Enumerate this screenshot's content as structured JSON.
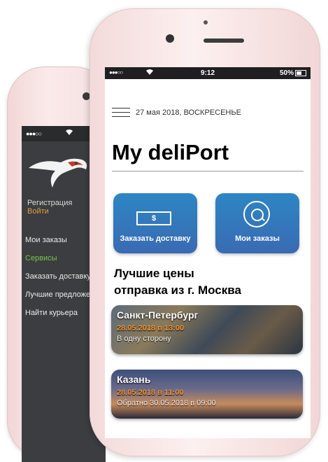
{
  "back_phone": {
    "status": {
      "signal": "●●●○○"
    },
    "account": {
      "register": "Регистрация",
      "login": "Войти"
    },
    "menu": [
      {
        "label": "Мои заказы",
        "active": false
      },
      {
        "label": "Сервисы",
        "active": true
      },
      {
        "label": "Заказать доставку",
        "active": false
      },
      {
        "label": "Лучшие предложения",
        "active": false
      },
      {
        "label": "Найти курьера",
        "active": false
      }
    ]
  },
  "front_phone": {
    "status": {
      "signal": "●●●○○",
      "time": "9:12",
      "battery": "50%"
    },
    "date": "27 мая 2018, ВОСКРЕСЕНЬЕ",
    "title": "My deliPort",
    "actions": {
      "order": {
        "label": "Заказать доставку",
        "icon_text": "$"
      },
      "my_orders": {
        "label": "Мои заказы"
      }
    },
    "section": {
      "line1": "Лучшие цены",
      "line2": "отправка из г. Москва"
    },
    "deals": [
      {
        "city": "Санкт-Петербург",
        "date": "28.05.2018 в 13:00",
        "trip": "В одну сторону"
      },
      {
        "city": "Казань",
        "date": "28.05.2018 в 11:00",
        "trip": "Обратно 30.05.2018 в 09:00"
      }
    ],
    "colors": {
      "accent_orange": "#f1932f",
      "button_blue": "#2d86c4",
      "menu_active": "#7bc34a"
    }
  }
}
